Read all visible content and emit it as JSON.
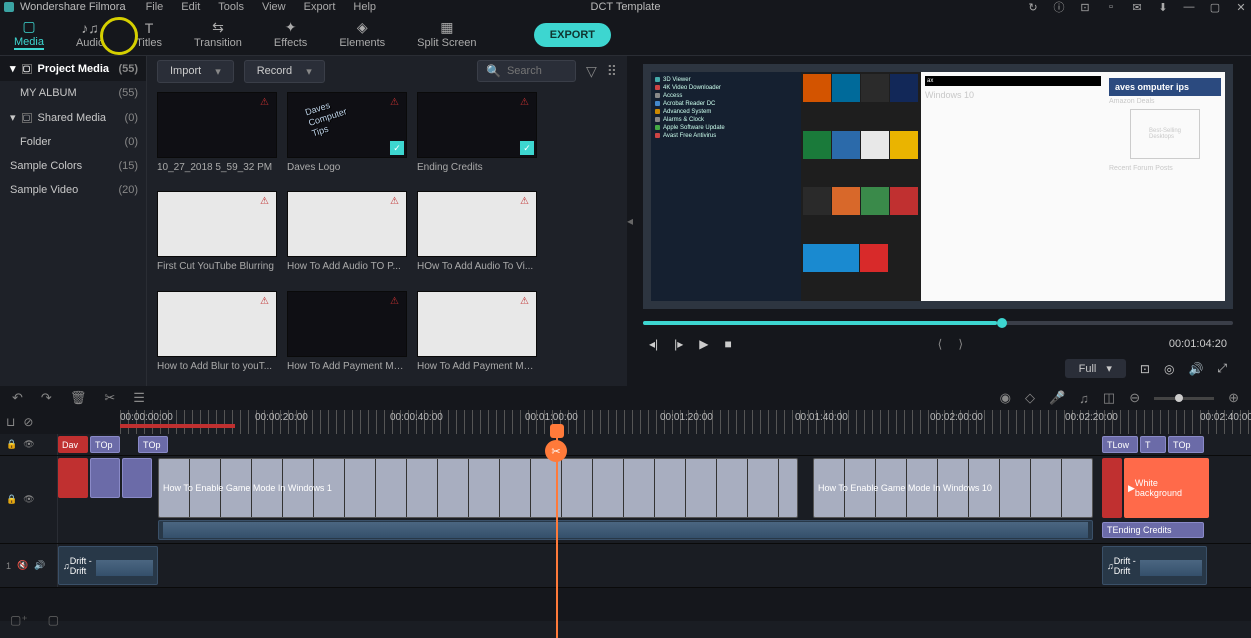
{
  "app": {
    "name": "Wondershare Filmora"
  },
  "menus": [
    "File",
    "Edit",
    "Tools",
    "View",
    "Export",
    "Help"
  ],
  "title": "DCT Template",
  "tabs": [
    {
      "label": "Media",
      "active": true
    },
    {
      "label": "Audio"
    },
    {
      "label": "Titles"
    },
    {
      "label": "Transition"
    },
    {
      "label": "Effects"
    },
    {
      "label": "Elements"
    },
    {
      "label": "Split Screen"
    }
  ],
  "export_label": "EXPORT",
  "sidebar": [
    {
      "label": "Project Media",
      "count": "(55)",
      "selected": true,
      "folder": true
    },
    {
      "label": "MY ALBUM",
      "count": "(55)",
      "indent": true
    },
    {
      "label": "Shared Media",
      "count": "(0)",
      "folder": true
    },
    {
      "label": "Folder",
      "count": "(0)",
      "indent": true
    },
    {
      "label": "Sample Colors",
      "count": "(15)"
    },
    {
      "label": "Sample Video",
      "count": "(20)"
    }
  ],
  "toolbar": {
    "import": "Import",
    "record": "Record",
    "search_placeholder": "Search"
  },
  "media": [
    {
      "label": "10_27_2018 5_59_32 PM",
      "dark": true,
      "warn": true
    },
    {
      "label": "Daves Logo",
      "dark": true,
      "warn": true,
      "check": true,
      "logo": true
    },
    {
      "label": "Ending Credits",
      "dark": true,
      "warn": true,
      "check": true
    },
    {
      "label": "First Cut YouTube Blurring",
      "light": true,
      "warn": true
    },
    {
      "label": "How To Add Audio TO P...",
      "light": true,
      "warn": true
    },
    {
      "label": "HOw To Add Audio To Vi...",
      "light": true,
      "warn": true
    },
    {
      "label": "How to Add Blur to youT...",
      "light": true,
      "warn": true
    },
    {
      "label": "How To Add Payment Me...",
      "dark": true,
      "warn": true
    },
    {
      "label": "How To Add Payment Me...",
      "light": true,
      "warn": true
    }
  ],
  "preview": {
    "banner": "aves omputer ips",
    "win10": "Windows 10",
    "amazon": "Amazon Deals",
    "forum": "Recent Forum Posts",
    "time": "00:01:04:20",
    "scale": "Full"
  },
  "ruler": {
    "labels": [
      "00:00:00:00",
      "00:00:20:00",
      "00:00:40:00",
      "00:01:00:00",
      "00:01:20:00",
      "00:01:40:00",
      "00:02:00:00",
      "00:02:20:00",
      "00:02:40:00"
    ]
  },
  "clips": {
    "t1a": "Dav",
    "t1b": "Op",
    "t1c": "Op",
    "t1d": "Low",
    "t1e": "T",
    "t1f": "Op",
    "v1": "How To Enable Game Mode In Windows 1",
    "v2": "How To Enable Game Mode In Windows 10",
    "wbg": "White background",
    "a1": "Drift - Drift",
    "a2": "Drift - Drift",
    "ec": "Ending Credits"
  }
}
